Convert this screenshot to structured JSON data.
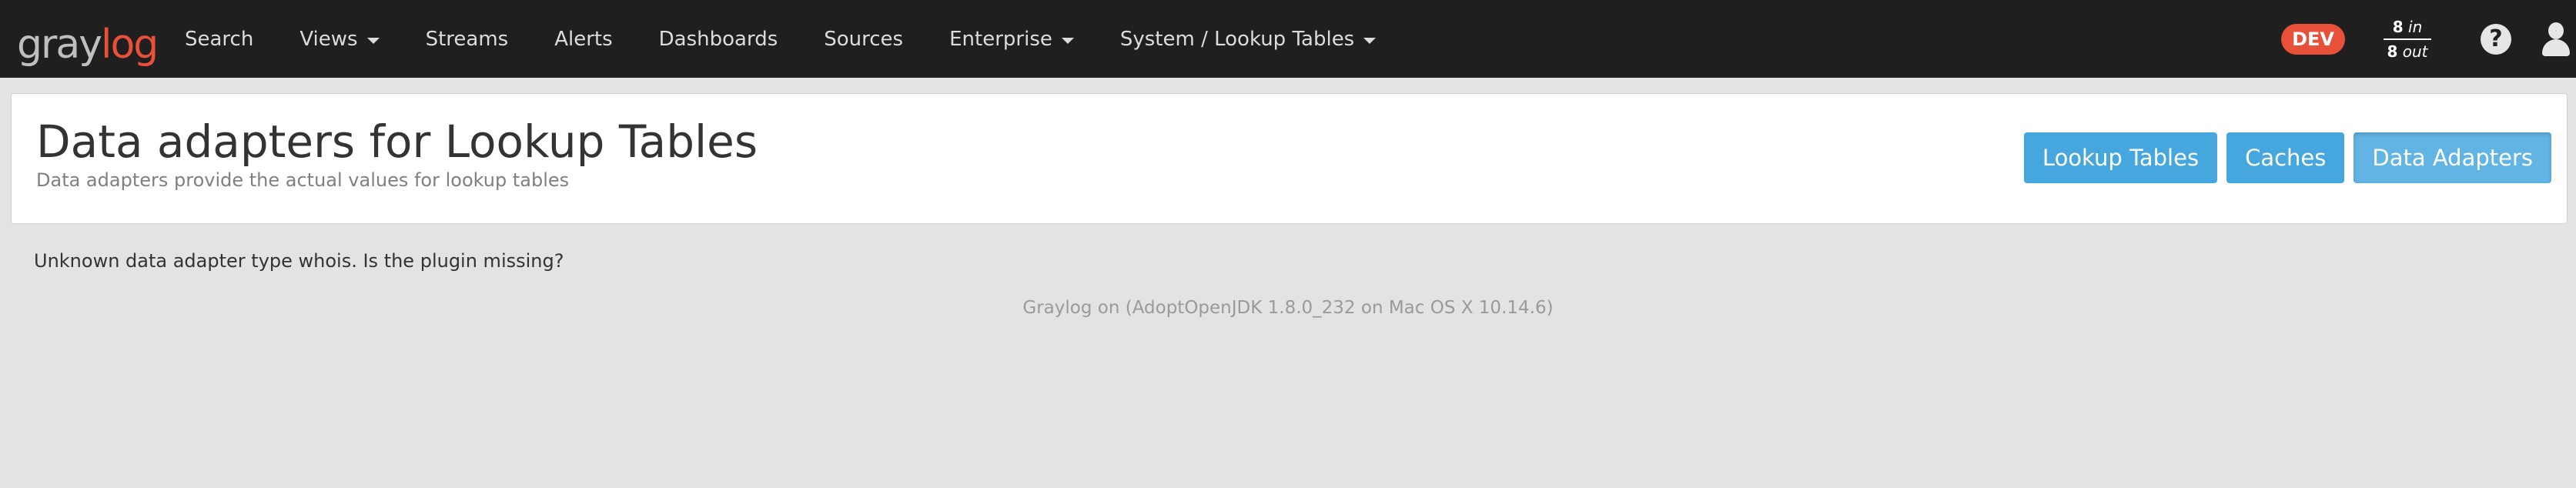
{
  "brand": {
    "logo_gray": "gray",
    "logo_red": "log",
    "accent_color": "#e8503a"
  },
  "nav": {
    "items": [
      {
        "label": "Search",
        "dropdown": false
      },
      {
        "label": "Views",
        "dropdown": true
      },
      {
        "label": "Streams",
        "dropdown": false
      },
      {
        "label": "Alerts",
        "dropdown": false
      },
      {
        "label": "Dashboards",
        "dropdown": false
      },
      {
        "label": "Sources",
        "dropdown": false
      },
      {
        "label": "Enterprise",
        "dropdown": true
      },
      {
        "label": "System / Lookup Tables",
        "dropdown": true
      }
    ],
    "env_badge": "DEV",
    "throughput": {
      "in_count": "8",
      "in_label": "in",
      "out_count": "8",
      "out_label": "out"
    },
    "help_icon": "question-circle-icon",
    "user_icon": "user-icon"
  },
  "header": {
    "title": "Data adapters for Lookup Tables",
    "subtitle": "Data adapters provide the actual values for lookup tables",
    "buttons": [
      {
        "label": "Lookup Tables",
        "active": false
      },
      {
        "label": "Caches",
        "active": false
      },
      {
        "label": "Data Adapters",
        "active": true
      }
    ],
    "button_color": "#46a7de"
  },
  "main": {
    "error_message": "Unknown data adapter type whois. Is the plugin missing?"
  },
  "footer": {
    "text": "Graylog on (AdoptOpenJDK 1.8.0_232 on Mac OS X 10.14.6)"
  }
}
